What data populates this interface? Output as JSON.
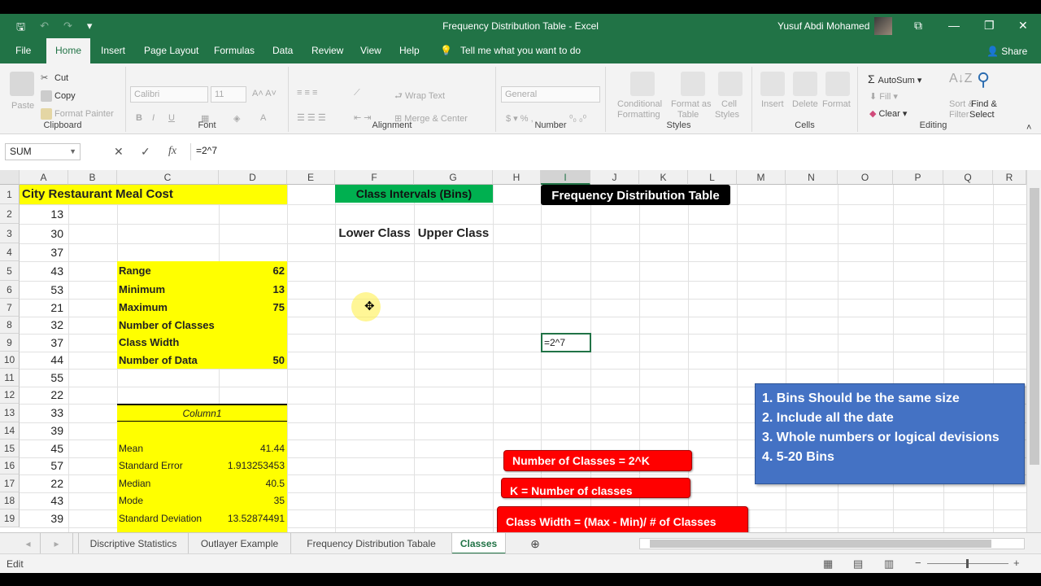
{
  "window": {
    "title": "Frequency Distribution Table  -  Excel",
    "user": "Yusuf Abdi Mohamed",
    "share": "Share"
  },
  "qat": {
    "save": "🖫",
    "undo": "↶",
    "redo": "↷",
    "customize": "▾"
  },
  "window_buttons": {
    "ribbon_display": "⧉",
    "minimize": "—",
    "restore": "❐",
    "close": "✕"
  },
  "menu": {
    "tabs": [
      "File",
      "Home",
      "Insert",
      "Page Layout",
      "Formulas",
      "Data",
      "Review",
      "View",
      "Help"
    ],
    "tell_me": "Tell me what you want to do"
  },
  "ribbon": {
    "clipboard": {
      "label": "Clipboard",
      "paste": "Paste",
      "cut": "Cut",
      "copy": "Copy",
      "format_painter": "Format Painter"
    },
    "font": {
      "label": "Font",
      "name": "Calibri",
      "size": "11",
      "bold": "B",
      "italic": "I",
      "underline": "U"
    },
    "alignment": {
      "label": "Alignment",
      "wrap": "Wrap Text",
      "merge": "Merge & Center"
    },
    "number": {
      "label": "Number",
      "format": "General"
    },
    "styles": {
      "label": "Styles",
      "conditional": "Conditional",
      "conditional2": "Formatting",
      "format_as": "Format as",
      "format_as2": "Table",
      "cell": "Cell",
      "cell2": "Styles"
    },
    "cells": {
      "label": "Cells",
      "insert": "Insert",
      "delete": "Delete",
      "format": "Format"
    },
    "editing": {
      "label": "Editing",
      "autosum": "AutoSum",
      "fill": "Fill",
      "clear": "Clear",
      "sort": "Sort &",
      "sort2": "Filter",
      "find": "Find &",
      "find2": "Select"
    }
  },
  "formula_bar": {
    "name_box": "SUM",
    "cancel": "✕",
    "enter": "✓",
    "fx": "fx",
    "formula": "=2^7"
  },
  "columns": [
    "A",
    "B",
    "C",
    "D",
    "E",
    "F",
    "G",
    "H",
    "I",
    "J",
    "K",
    "L",
    "M",
    "N",
    "O",
    "P",
    "Q",
    "R"
  ],
  "rows": [
    "1",
    "2",
    "3",
    "4",
    "5",
    "6",
    "7",
    "8",
    "9",
    "10",
    "11",
    "12",
    "13",
    "14",
    "15",
    "16",
    "17",
    "18",
    "19"
  ],
  "sheet": {
    "A1": "City Restaurant Meal Cost",
    "a_values": [
      "13",
      "30",
      "37",
      "43",
      "53",
      "21",
      "32",
      "37",
      "44",
      "55",
      "22",
      "33",
      "39",
      "45",
      "57",
      "22",
      "43",
      "39"
    ],
    "F1": "Class Intervals (Bins)",
    "F3": "Lower Class",
    "G3": "Upper Class",
    "I1": "Frequency Distribution Table",
    "I9": "=2^7",
    "stats": [
      {
        "label": "Range",
        "value": "62"
      },
      {
        "label": "Minimum",
        "value": "13"
      },
      {
        "label": "Maximum",
        "value": "75"
      },
      {
        "label": "Number of Classes",
        "value": ""
      },
      {
        "label": "Class Width",
        "value": ""
      },
      {
        "label": "Number of Data",
        "value": "50"
      }
    ],
    "C13": "Column1",
    "descriptive": [
      {
        "label": "Mean",
        "value": "41.44"
      },
      {
        "label": "Standard Error",
        "value": "1.913253453"
      },
      {
        "label": "Median",
        "value": "40.5"
      },
      {
        "label": "Mode",
        "value": "35"
      },
      {
        "label": "Standard Deviation",
        "value": "13.52874491"
      }
    ]
  },
  "shapes": {
    "rule1": "Number of Classes = 2^K",
    "rule2": "K = Number of classes",
    "rule3": "Class Width = (Max - Min)/ # of Classes",
    "notes": [
      "1.  Bins Should be the same size",
      "2. Include all the date",
      "3. Whole numbers or logical devisions",
      "4.  5-20  Bins"
    ]
  },
  "sheet_tabs": [
    "Discriptive Statistics",
    "Outlayer Example",
    "Frequency Distribution Tabale",
    "Classes"
  ],
  "status": {
    "mode": "Edit"
  },
  "colors": {
    "excel_green": "#217346",
    "yellow": "#ffff00",
    "header_green": "#00b050",
    "red": "#ff0000",
    "blue": "#4472c4"
  }
}
